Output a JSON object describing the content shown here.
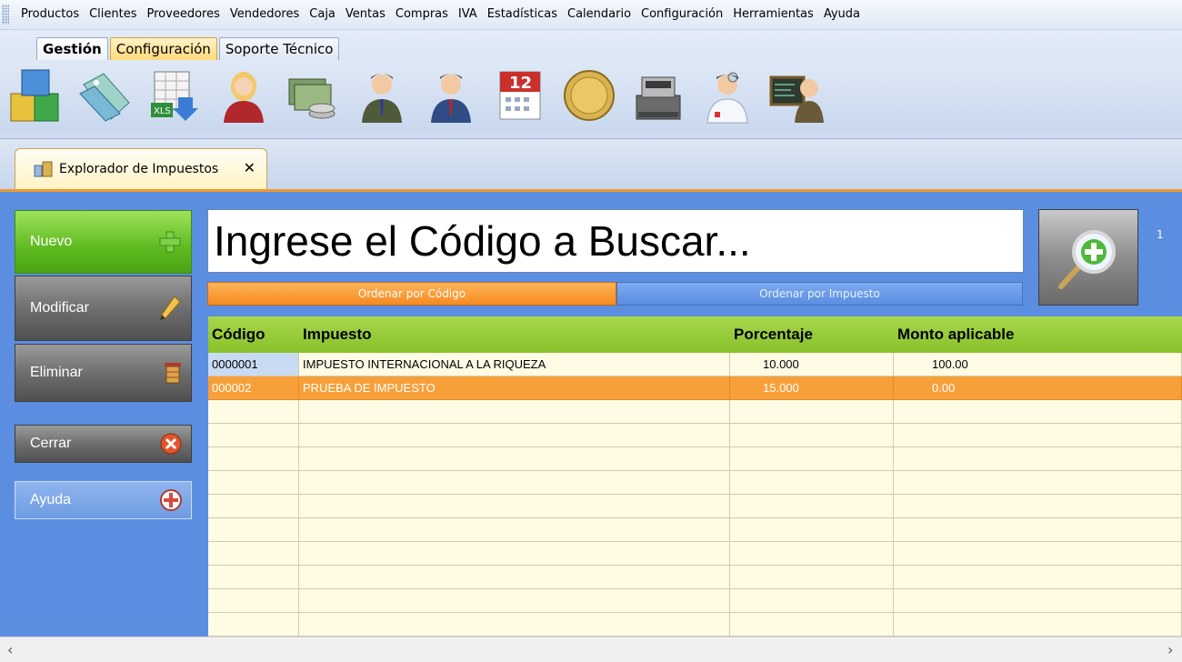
{
  "menu": [
    "Productos",
    "Clientes",
    "Proveedores",
    "Vendedores",
    "Caja",
    "Ventas",
    "Compras",
    "IVA",
    "Estadísticas",
    "Calendario",
    "Configuración",
    "Herramientas",
    "Ayuda"
  ],
  "ribbon": {
    "tabs": [
      {
        "label": "Gestión"
      },
      {
        "label": "Configuración"
      },
      {
        "label": "Soporte Técnico"
      }
    ],
    "icons": [
      "products-cubes-icon",
      "price-tags-icon",
      "excel-export-icon",
      "female-client-icon",
      "money-stack-icon",
      "male-vendor-icon",
      "male-supplier-icon",
      "calendar-icon",
      "coin-icon",
      "cash-register-icon",
      "doctor-support-icon",
      "teacher-blackboard-icon"
    ],
    "calendar_day": "12"
  },
  "doc_tab": {
    "label": "Explorador de Impuestos",
    "close": "✕"
  },
  "sidebar": {
    "nuevo": "Nuevo",
    "modificar": "Modificar",
    "eliminar": "Eliminar",
    "cerrar": "Cerrar",
    "ayuda": "Ayuda"
  },
  "search": {
    "placeholder": "Ingrese el Código a Buscar..."
  },
  "page_label": "1",
  "sort": {
    "by_code": "Ordenar por Código",
    "by_tax": "Ordenar por Impuesto"
  },
  "table": {
    "columns": [
      "Código",
      "Impuesto",
      "Porcentaje",
      "Monto aplicable"
    ],
    "rows": [
      {
        "codigo": "0000001",
        "impuesto": "IMPUESTO INTERNACIONAL A LA RIQUEZA",
        "porcentaje": "10.000",
        "monto": "100.00"
      },
      {
        "codigo": "000002",
        "impuesto": "PRUEBA DE IMPUESTO",
        "porcentaje": "15.000",
        "monto": "0.00"
      }
    ]
  },
  "scroll": {
    "left": "‹",
    "right": "›"
  },
  "colors": {
    "accent_orange": "#f58a1f",
    "header_green": "#88c22a",
    "main_blue": "#5b8ee0",
    "grid_bg": "#fffbe5"
  }
}
